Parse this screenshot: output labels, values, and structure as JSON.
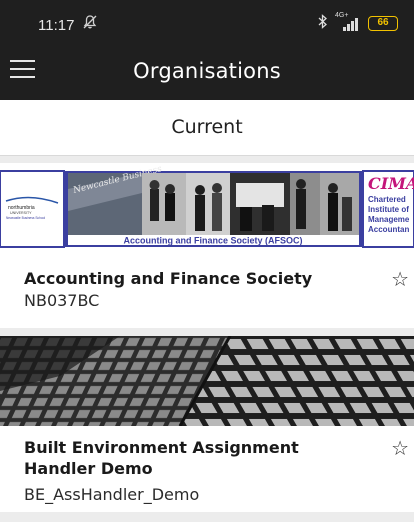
{
  "status_bar": {
    "time": "11:17",
    "mute_icon": "bell-off-icon",
    "bluetooth_icon": "bluetooth-icon",
    "network": "4G+",
    "battery": "66"
  },
  "app_bar": {
    "menu_icon": "hamburger-menu-icon",
    "title": "Organisations"
  },
  "tabs": {
    "current": "Current"
  },
  "organisations": [
    {
      "name": "Accounting and Finance Society",
      "code": "NB037BC",
      "favourite": false,
      "banner": {
        "left_logo_line1": "northumbria",
        "left_logo_line2": "UNIVERSITY",
        "left_logo_line3": "Newcastle Business School",
        "sign_text": "Newcastle Business",
        "caption": "Accounting and Finance Society (AFSOC)",
        "right_logo_mark": "CIMA",
        "right_logo_lines": [
          "Chartered",
          "Institute of",
          "Manageme",
          "Accountan"
        ]
      }
    },
    {
      "name": "Built Environment Assignment Handler Demo",
      "code": "BE_AssHandler_Demo",
      "favourite": false
    }
  ],
  "colors": {
    "app_bar": "#1f1f1f",
    "background": "#ececec",
    "card": "#ffffff",
    "cima_magenta": "#c4157a",
    "banner_border": "#3b3fa0"
  }
}
